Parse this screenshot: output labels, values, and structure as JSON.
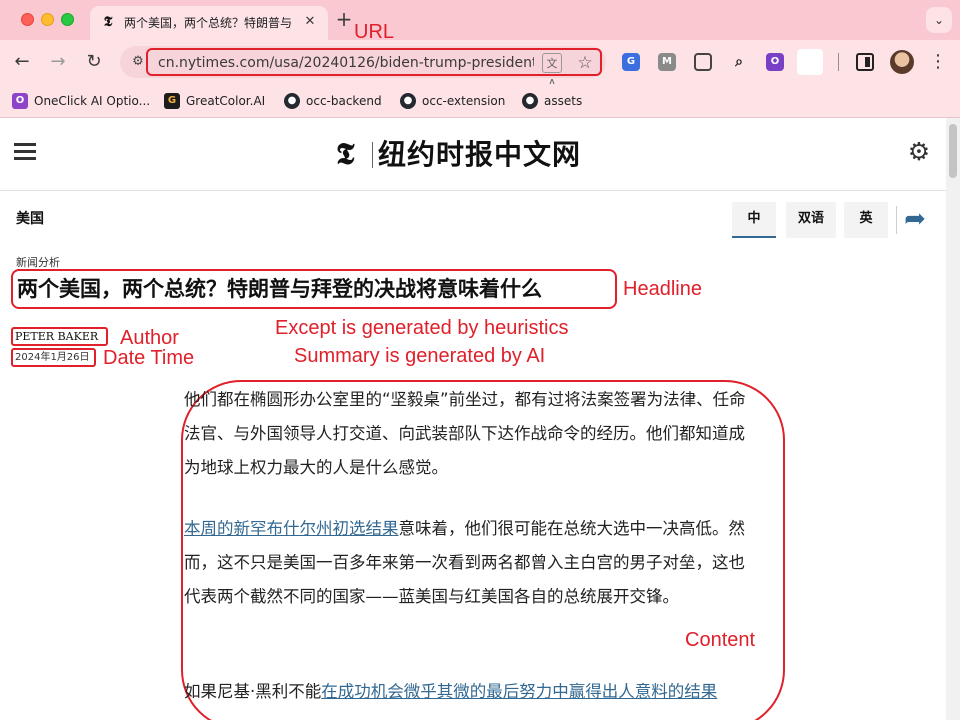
{
  "browser": {
    "tab_favicon": "𝕿",
    "tab_title": "两个美国，两个总统？特朗普与",
    "tab_close": "✕",
    "new_tab": "+",
    "tab_menu": "⌄",
    "url": "cn.nytimes.com/usa/20240126/biden-trump-presidenti...",
    "nav": {
      "back": "←",
      "forward": "→",
      "reload": "↻"
    },
    "bookmarks": [
      {
        "label": "OneClick AI Optio...",
        "icon": "oneclick-icon"
      },
      {
        "label": "GreatColor.AI",
        "icon": "greatcolor-icon"
      },
      {
        "label": "occ-backend",
        "icon": "github-icon"
      },
      {
        "label": "occ-extension",
        "icon": "github-icon"
      },
      {
        "label": "assets",
        "icon": "github-icon"
      }
    ]
  },
  "site": {
    "logo_glyph": "𝕿",
    "name": "纽约时报中文网",
    "section": "美国",
    "lang_buttons": [
      "中",
      "双语",
      "英"
    ]
  },
  "article": {
    "kicker": "新闻分析",
    "headline": "两个美国，两个总统？特朗普与拜登的决战将意味着什么",
    "author": "PETER BAKER",
    "date": "2024年1月26日",
    "p1": "他们都在椭圆形办公室里的“坚毅桌”前坐过，都有过将法案签署为法律、任命法官、与外国领导人打交道、向武装部队下达作战命令的经历。他们都知道成为地球上权力最大的人是什么感觉。",
    "p2_link": "本周的新罕布什尔州初选结果",
    "p2_text": "意味着，他们很可能在总统大选中一决高低。然而，这不只是美国一百多年来第一次看到两名都曾入主白宫的男子对垒，这也代表两个截然不同的国家——蓝美国与红美国各自的总统展开交锋。",
    "p3_text": "如果尼基·黑利不能",
    "p3_link": "在成功机会微乎其微的最后努力中赢得出人意料的结果"
  },
  "annotations": {
    "url": "URL",
    "headline": "Headline",
    "author": "Author",
    "date": "Date Time",
    "excerpt": "Except is generated by heuristics",
    "summary": "Summary is generated by AI",
    "content": "Content"
  },
  "colors": {
    "annotation": "#e0202a",
    "link": "#326891",
    "chrome": "#fde2e6"
  }
}
